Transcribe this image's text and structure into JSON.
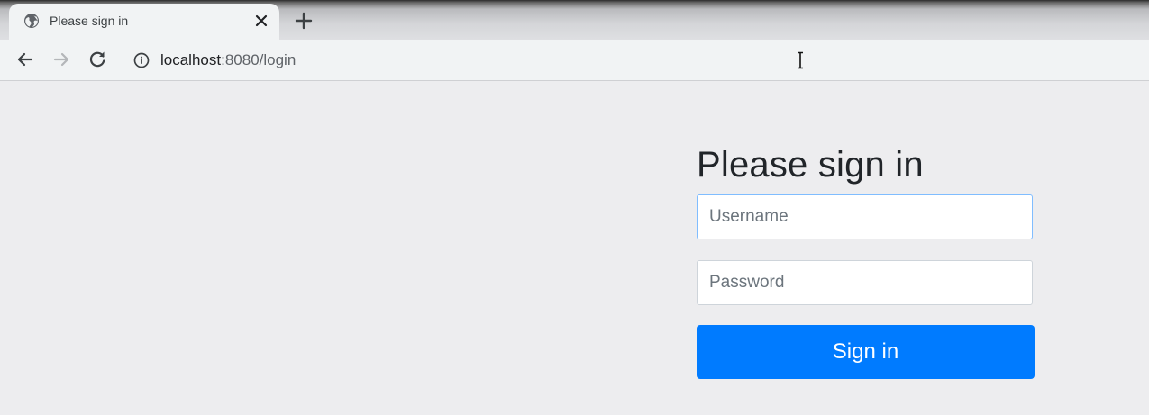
{
  "browser": {
    "tab": {
      "title": "Please sign in",
      "icon": "globe-icon",
      "close_icon": "close-icon"
    },
    "new_tab_icon": "plus-icon",
    "toolbar": {
      "back_icon": "back-arrow-icon",
      "forward_icon": "forward-arrow-icon",
      "reload_icon": "reload-icon",
      "info_icon": "info-icon"
    },
    "address": {
      "host": "localhost",
      "rest": ":8080/login"
    }
  },
  "login": {
    "heading": "Please sign in",
    "username_placeholder": "Username",
    "password_placeholder": "Password",
    "submit_label": "Sign in"
  },
  "colors": {
    "page_background": "#ededef",
    "button_primary": "#007bff",
    "focus_border": "#80bdff",
    "heading_text": "#212529"
  }
}
